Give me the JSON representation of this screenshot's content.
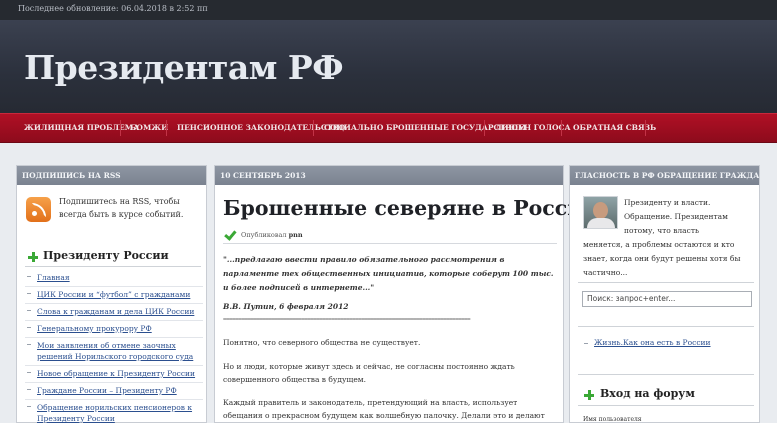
{
  "topbar": {
    "last_update": "Последнее обновление: 06.04.2018 в 2:52 пп"
  },
  "header": {
    "site_title": "Президентам РФ"
  },
  "nav": {
    "items": [
      "Жилищная проблема",
      "БОМЖи",
      "Пенсионное законодательство",
      "Социально брошенные государством",
      "Лишен голоса",
      "Обратная связь"
    ]
  },
  "left": {
    "rss_header": "Подпишись на RSS",
    "rss_text": "Подпишитесь на RSS, чтобы всегда быть в курсе событий.",
    "widget_title": "Президенту России",
    "links": [
      "Главная",
      "ЦИК России и “футбол” с гражданами",
      "Слова к гражданам и дела ЦИК России",
      "Генеральному прокурору РФ",
      "Мои заявления об отмене заочных решений Норильского городского суда",
      "Новое обращение к Президенту России",
      "Граждане России – Президенту РФ",
      "Обращение норильских пенсионеров к Президенту России"
    ]
  },
  "post": {
    "date_header": "10 Сентябрь 2013",
    "title": "Брошенные северяне в России",
    "author_prefix": "Опубликовал",
    "author": "pnn",
    "quote": "\"...предлагаю ввести правило обязательного рассмотрения в парламенте тех общественных инициатив, которые соберут 100 тыс. и более подписей в интернете...\"",
    "signature": "В.В. Путин, 6 февраля 2012",
    "separator": "==================================================================================",
    "paragraphs": [
      "Понятно, что северного общества не существует.",
      "Но и люди, которые живут здесь и сейчас, не согласны постоянно ждать совершенного общества в будущем.",
      "Каждый правитель и законодатель, претендующий на власть, использует обещания о прекрасном будущем как волшебную палочку. Делали это и делают все политики. Но, как"
    ]
  },
  "right": {
    "header": "Гласность в РФ Обращение граждан к власти",
    "text_a": "Президенту и власти. Обращение. Президентам потому, что власть",
    "text_b": "меняется, а проблемы остаются и кто знает, когда они будут решены хотя бы частично...",
    "search_placeholder": "Поиск: запрос+enter...",
    "link": "Жизнь.Как она есть в России",
    "login_title": "Вход на форум",
    "login_label": "Имя пользователя"
  }
}
